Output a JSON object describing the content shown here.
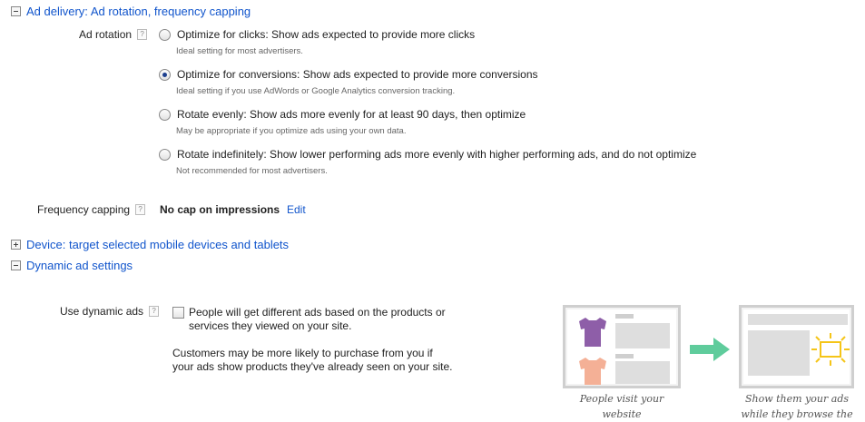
{
  "ad_delivery": {
    "header": "Ad delivery: Ad rotation, frequency capping",
    "ad_rotation_label": "Ad rotation",
    "options": [
      {
        "label": "Optimize for clicks: Show ads expected to provide more clicks",
        "note": "Ideal setting for most advertisers.",
        "checked": false
      },
      {
        "label": "Optimize for conversions: Show ads expected to provide more conversions",
        "note": "Ideal setting if you use AdWords or Google Analytics conversion tracking.",
        "checked": true
      },
      {
        "label": "Rotate evenly: Show ads more evenly for at least 90 days, then optimize",
        "note": "May be appropriate if you optimize ads using your own data.",
        "checked": false
      },
      {
        "label": "Rotate indefinitely: Show lower performing ads more evenly with higher performing ads, and do not optimize",
        "note": "Not recommended for most advertisers.",
        "checked": false
      }
    ],
    "frequency_label": "Frequency capping",
    "frequency_value": "No cap on impressions",
    "edit_label": "Edit"
  },
  "device": {
    "header": "Device: target selected mobile devices and tablets"
  },
  "dynamic": {
    "header": "Dynamic ad settings",
    "use_label": "Use dynamic ads",
    "checkbox_text": "People will get different ads based on the products or services they viewed on your site.",
    "description": "Customers may be more likely to purchase from you if your ads show products they've already seen on your site.",
    "caption_left_line1": "People visit your",
    "caption_left_line2": "website",
    "caption_right_line1": "Show them your ads",
    "caption_right_line2": "while they browse the"
  },
  "help_glyph": "?",
  "colors": {
    "link": "#1155cc",
    "shirt_purple": "#8e5ea8",
    "shirt_peach": "#f4b096",
    "arrow_green": "#5fcc9c",
    "highlight_yellow": "#f5c518"
  }
}
